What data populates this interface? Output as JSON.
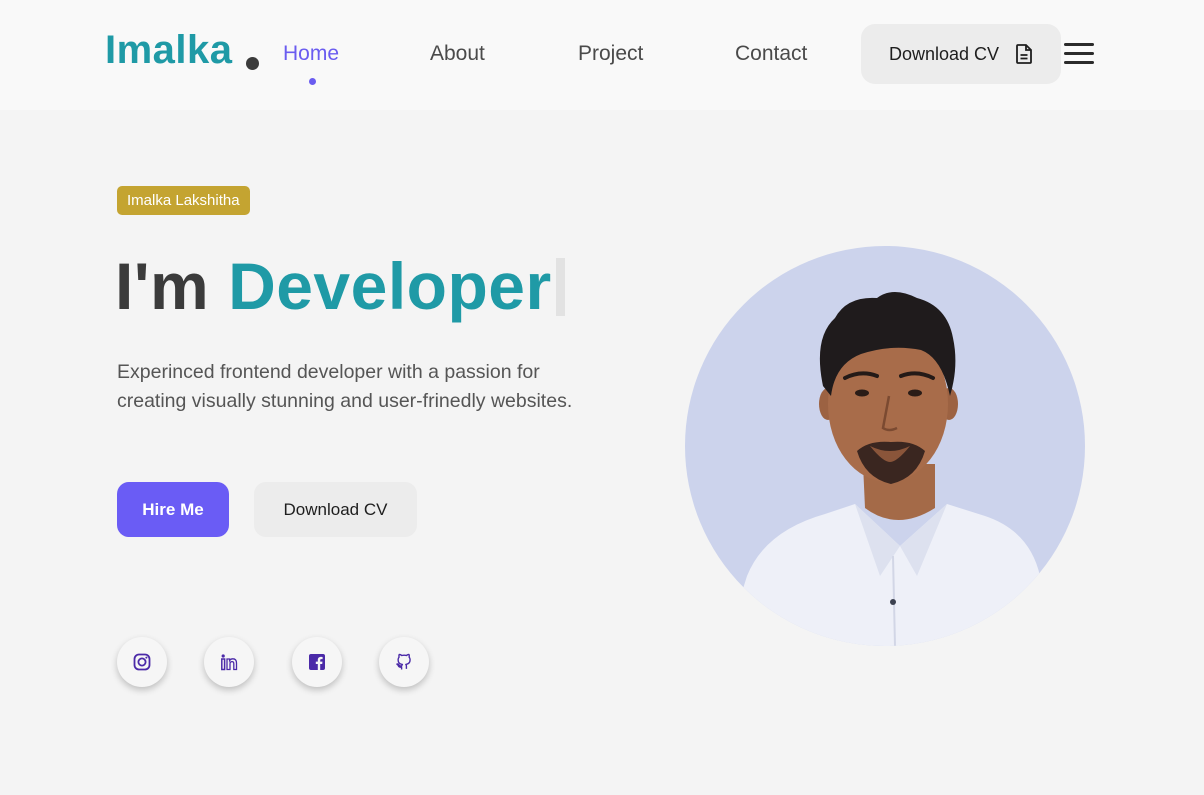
{
  "header": {
    "logo": "Imalka",
    "nav": [
      {
        "label": "Home",
        "active": true
      },
      {
        "label": "About",
        "active": false
      },
      {
        "label": "Project",
        "active": false
      },
      {
        "label": "Contact",
        "active": false
      }
    ],
    "download_label": "Download CV",
    "download_icon": "file-icon",
    "menu_icon": "hamburger-icon"
  },
  "hero": {
    "badge": "Imalka Lakshitha",
    "headline_prefix": "I'm",
    "headline_accent": "Developer",
    "description": "Experinced frontend developer with a passion for creating visually stunning and user-frinedly websites.",
    "hire_label": "Hire Me",
    "download_label": "Download CV"
  },
  "social": [
    {
      "icon": "instagram-icon"
    },
    {
      "icon": "linkedin-icon"
    },
    {
      "icon": "facebook-icon"
    },
    {
      "icon": "github-icon"
    }
  ],
  "colors": {
    "accent_teal": "#1f9aa6",
    "accent_purple": "#6a5cf5",
    "badge_gold": "#c4a431",
    "social_icon": "#4b2aa8",
    "portrait_bg": "#ccd3ec"
  }
}
